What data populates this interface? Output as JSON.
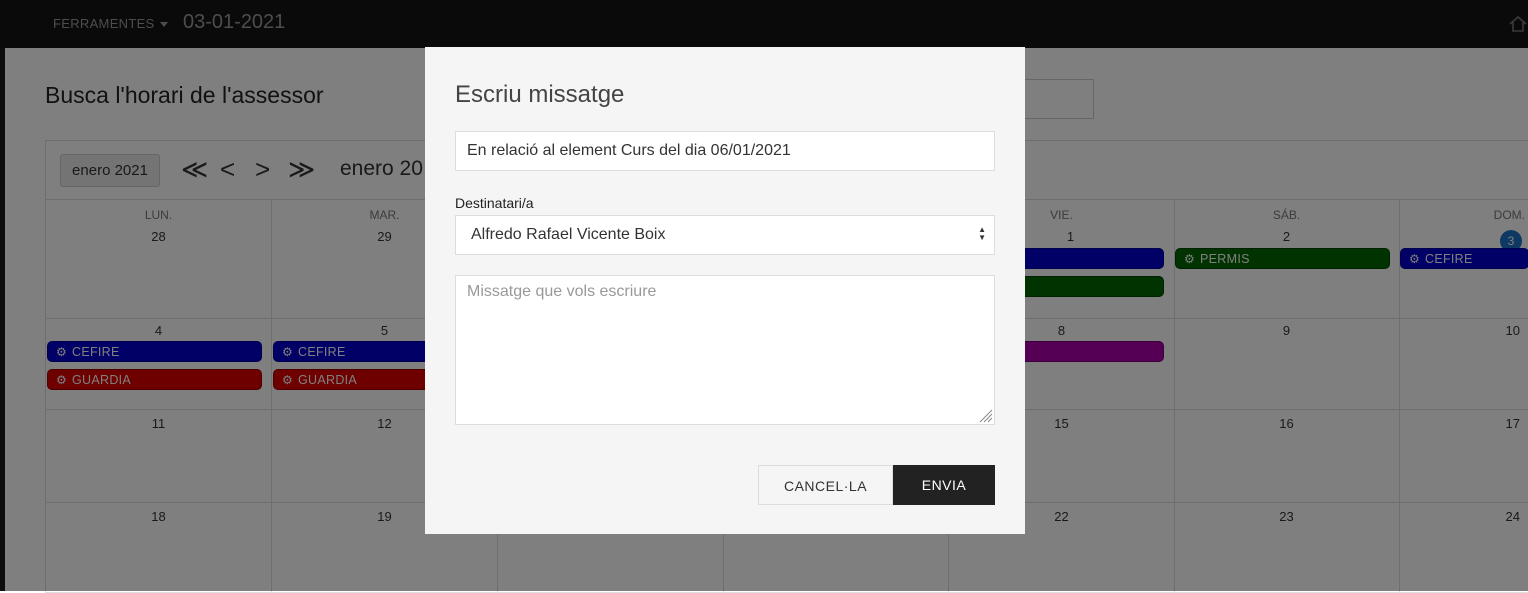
{
  "topbar": {
    "tools_label": "FERRAMENTES",
    "date": "03-01-2021"
  },
  "page": {
    "title": "Busca l'horari de l'assessor"
  },
  "calendar": {
    "month_button": "enero 2021",
    "nav": [
      "≪",
      "<",
      ">",
      "≫"
    ],
    "month_label": "enero 20",
    "day_headers": [
      "LUN.",
      "MAR.",
      "",
      "",
      "VIE.",
      "SÁB.",
      "DOM."
    ],
    "weeks": [
      [
        "28",
        "29",
        "",
        "",
        "1",
        "2",
        "3"
      ],
      [
        "4",
        "5",
        "",
        "",
        "8",
        "9",
        "10"
      ],
      [
        "11",
        "12",
        "",
        "",
        "15",
        "16",
        "17"
      ],
      [
        "18",
        "19",
        "",
        "",
        "22",
        "23",
        "24"
      ]
    ],
    "events": {
      "mon4_a": "CEFIRE",
      "mon4_b": "GUARDIA",
      "tue5_a": "CEFIRE",
      "tue5_b": "GUARDIA",
      "sat2": "PERMIS",
      "sun3": "CEFIRE"
    },
    "colors": {
      "blue": "#0000cc",
      "red": "#dd0000",
      "green": "#006600",
      "purple": "#aa00aa",
      "today": "#1a73c4"
    }
  },
  "modal": {
    "title": "Escriu missatge",
    "subject_value": "En relació al element Curs del dia 06/01/2021",
    "recipient_label": "Destinatari/a",
    "recipient_value": "Alfredo Rafael Vicente Boix",
    "message_placeholder": "Missatge que vols escriure",
    "cancel_label": "CANCEL·LA",
    "send_label": "ENVIA"
  }
}
